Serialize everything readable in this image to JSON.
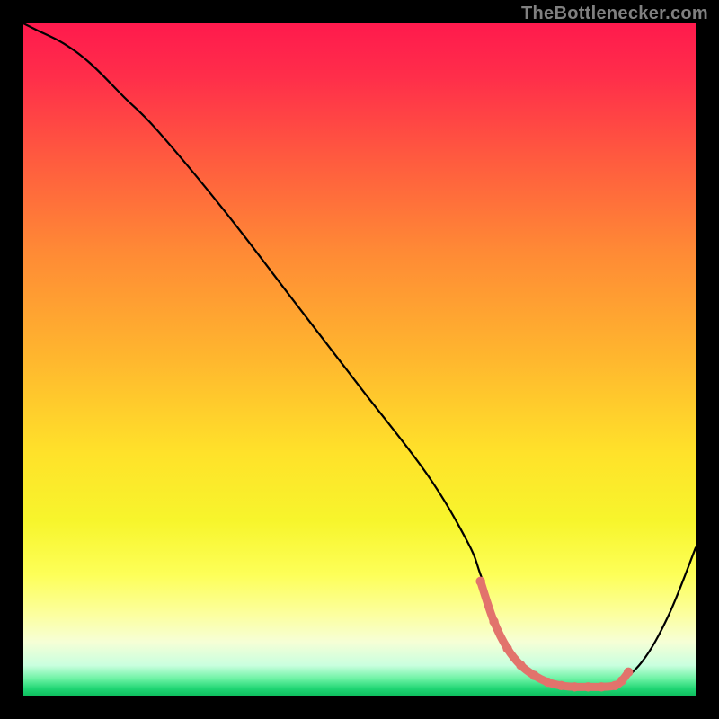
{
  "attribution": "TheBottlenecker.com",
  "chart_data": {
    "type": "line",
    "title": "",
    "xlabel": "",
    "ylabel": "",
    "xlim": [
      0,
      100
    ],
    "ylim": [
      0,
      100
    ],
    "grid": false,
    "background": "rainbow-vertical-gradient",
    "series": [
      {
        "name": "main-curve",
        "color": "#000000",
        "x": [
          0,
          2,
          6,
          10,
          15,
          20,
          30,
          40,
          50,
          60,
          66,
          68,
          70,
          72,
          76,
          80,
          82,
          84,
          86,
          88,
          92,
          96,
          100
        ],
        "values": [
          100,
          99,
          97,
          94,
          89,
          84,
          72,
          59,
          46,
          33,
          23,
          18,
          12,
          7,
          3,
          1.5,
          1.3,
          1.3,
          1.3,
          1.6,
          5,
          12,
          22
        ]
      },
      {
        "name": "highlight-band",
        "color": "#e2736c",
        "style": "thick-dotted",
        "x": [
          68,
          70,
          72,
          74,
          76,
          78,
          80,
          82,
          84,
          86,
          88,
          89,
          90
        ],
        "values": [
          17,
          11,
          7,
          4.5,
          3,
          2,
          1.5,
          1.3,
          1.3,
          1.3,
          1.5,
          2.2,
          3.5
        ]
      }
    ],
    "gradient_stops": [
      {
        "offset": 0.0,
        "color": "#ff1a4d"
      },
      {
        "offset": 0.08,
        "color": "#ff2e4a"
      },
      {
        "offset": 0.2,
        "color": "#ff5a3f"
      },
      {
        "offset": 0.34,
        "color": "#ff8a35"
      },
      {
        "offset": 0.5,
        "color": "#ffb72e"
      },
      {
        "offset": 0.64,
        "color": "#ffe22a"
      },
      {
        "offset": 0.74,
        "color": "#f7f52c"
      },
      {
        "offset": 0.82,
        "color": "#fdff58"
      },
      {
        "offset": 0.88,
        "color": "#fcffa0"
      },
      {
        "offset": 0.92,
        "color": "#f6ffd6"
      },
      {
        "offset": 0.955,
        "color": "#c9ffdf"
      },
      {
        "offset": 0.975,
        "color": "#6cf2a4"
      },
      {
        "offset": 0.99,
        "color": "#1fd573"
      },
      {
        "offset": 1.0,
        "color": "#0fbf5f"
      }
    ]
  }
}
